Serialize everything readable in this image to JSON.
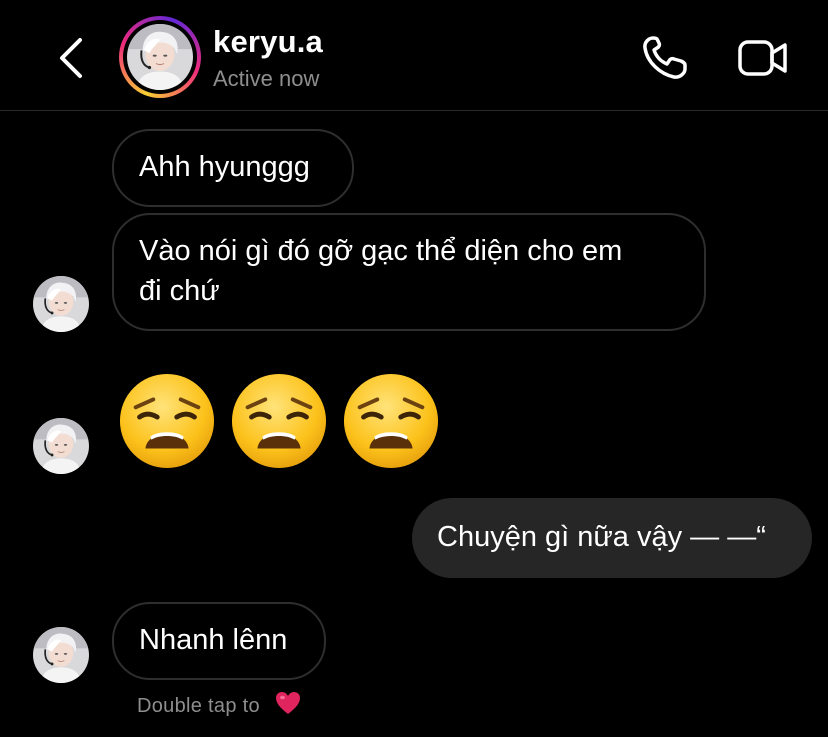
{
  "header": {
    "username": "keryu.a",
    "status": "Active now",
    "back_icon": "chevron-left-icon",
    "call_icon": "phone-icon",
    "video_icon": "video-camera-icon"
  },
  "messages": [
    {
      "sender": "other",
      "text": "Ahh hyunggg"
    },
    {
      "sender": "other",
      "text_line1": "Vào nói gì đó gỡ gạc thể diện cho em",
      "text_line2": "đi chứ"
    },
    {
      "sender": "other",
      "type": "emoji",
      "emoji_count": 3,
      "emoji_name": "weary-face-emoji"
    },
    {
      "sender": "me",
      "text": "Chuyện gì nữa vậy — —“"
    },
    {
      "sender": "other",
      "text": "Nhanh lênn"
    }
  ],
  "footer": {
    "hint": "Double tap to",
    "hint_icon": "red-heart-emoji"
  },
  "colors": {
    "background": "#000000",
    "bubble_outgoing": "#262626",
    "bubble_incoming_border": "#2e2e2e",
    "secondary_text": "#8e8e8e",
    "emoji_yellow": "#fcc21b",
    "heart_red": "#e0245e"
  }
}
